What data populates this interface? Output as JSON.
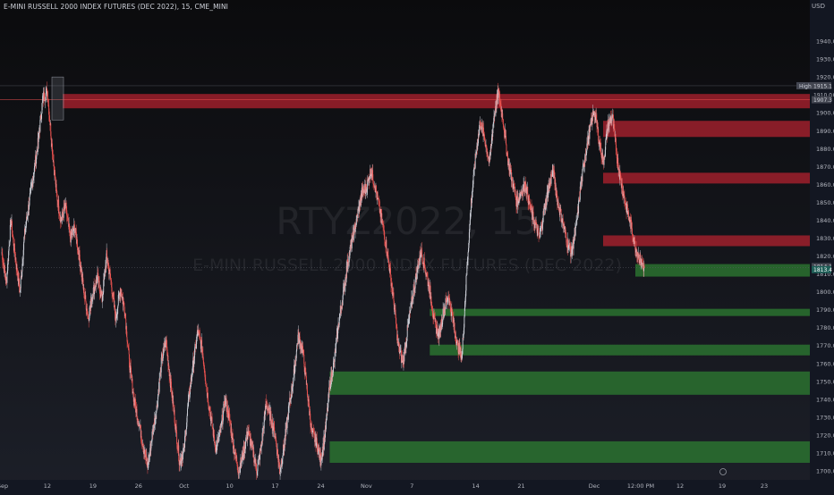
{
  "header": {
    "symbol_line": "E-MINI RUSSELL 2000 INDEX FUTURES (DEC 2022), 15, CME_MINI",
    "currency": "USD"
  },
  "watermark": {
    "symbol": "RTYZ2022, 15",
    "description": "E-MINI RUSSELL 2000 INDEX FUTURES (DEC 2022)"
  },
  "colors": {
    "background": "#131722",
    "supply_zone": "#b2222f",
    "demand_zone": "#2e7d32",
    "candle_up": "#d1d4dc",
    "candle_down": "#ef5350"
  },
  "chart_data": {
    "type": "candlestick",
    "ylim": [
      1696,
      1956
    ],
    "y_ticks": [
      1940,
      1930,
      1920,
      1910,
      1900,
      1890,
      1880,
      1870,
      1860,
      1850,
      1840,
      1830,
      1820,
      1810,
      1800,
      1790,
      1780,
      1770,
      1760,
      1750,
      1740,
      1730,
      1720,
      1710,
      1700
    ],
    "y_tick_labels": [
      "1940.0",
      "1930.0",
      "1920.0",
      "1910.0",
      "1900.0",
      "1890.0",
      "1880.0",
      "1870.0",
      "1860.0",
      "1850.0",
      "1840.0",
      "1830.0",
      "1820.0",
      "1810.0",
      "1800.0",
      "1790.0",
      "1780.0",
      "1770.0",
      "1760.0",
      "1750.0",
      "1740.0",
      "1730.0",
      "1720.0",
      "1710.0",
      "1700.0"
    ],
    "x_ticks": [
      "Sep",
      "12",
      "19",
      "26",
      "Oct",
      "10",
      "17",
      "24",
      "Nov",
      "7",
      "14",
      "21",
      "Dec",
      "12:00 PM",
      "12",
      "19",
      "23"
    ],
    "price_labels": [
      {
        "label": "High",
        "value": "1915.1"
      },
      {
        "label": "",
        "value": "1910.0"
      },
      {
        "label": "",
        "value": "1907.3"
      },
      {
        "label": "",
        "value": "1814.1"
      },
      {
        "label": "",
        "value": "1813.4"
      }
    ],
    "path": [
      [
        "Sep",
        1822
      ],
      [
        "",
        1805
      ],
      [
        "",
        1840
      ],
      [
        "",
        1818
      ],
      [
        "",
        1800
      ],
      [
        "",
        1832
      ],
      [
        "",
        1850
      ],
      [
        "",
        1866
      ],
      [
        "",
        1884
      ],
      [
        "",
        1908
      ],
      [
        "12",
        1912
      ],
      [
        "",
        1882
      ],
      [
        "",
        1855
      ],
      [
        "",
        1840
      ],
      [
        "",
        1848
      ],
      [
        "",
        1830
      ],
      [
        "",
        1836
      ],
      [
        "",
        1820
      ],
      [
        "",
        1800
      ],
      [
        "",
        1786
      ],
      [
        "19",
        1800
      ],
      [
        "",
        1808
      ],
      [
        "",
        1796
      ],
      [
        "",
        1820
      ],
      [
        "",
        1805
      ],
      [
        "",
        1785
      ],
      [
        "",
        1802
      ],
      [
        "",
        1790
      ],
      [
        "",
        1760
      ],
      [
        "",
        1740
      ],
      [
        "26",
        1728
      ],
      [
        "",
        1715
      ],
      [
        "",
        1702
      ],
      [
        "",
        1720
      ],
      [
        "",
        1735
      ],
      [
        "",
        1760
      ],
      [
        "",
        1773
      ],
      [
        "",
        1750
      ],
      [
        "",
        1728
      ],
      [
        "",
        1705
      ],
      [
        "Oct",
        1712
      ],
      [
        "",
        1740
      ],
      [
        "",
        1760
      ],
      [
        "",
        1778
      ],
      [
        "",
        1768
      ],
      [
        "",
        1745
      ],
      [
        "",
        1728
      ],
      [
        "",
        1712
      ],
      [
        "",
        1722
      ],
      [
        "",
        1740
      ],
      [
        "10",
        1728
      ],
      [
        "",
        1712
      ],
      [
        "",
        1700
      ],
      [
        "",
        1710
      ],
      [
        "",
        1722
      ],
      [
        "",
        1712
      ],
      [
        "",
        1700
      ],
      [
        "",
        1715
      ],
      [
        "",
        1738
      ],
      [
        "",
        1730
      ],
      [
        "17",
        1720
      ],
      [
        "",
        1700
      ],
      [
        "",
        1715
      ],
      [
        "",
        1735
      ],
      [
        "",
        1752
      ],
      [
        "",
        1775
      ],
      [
        "",
        1768
      ],
      [
        "",
        1745
      ],
      [
        "",
        1722
      ],
      [
        "",
        1716
      ],
      [
        "24",
        1706
      ],
      [
        "",
        1722
      ],
      [
        "",
        1748
      ],
      [
        "",
        1762
      ],
      [
        "",
        1784
      ],
      [
        "",
        1800
      ],
      [
        "",
        1818
      ],
      [
        "",
        1830
      ],
      [
        "",
        1842
      ],
      [
        "",
        1855
      ],
      [
        "Nov",
        1858
      ],
      [
        "",
        1868
      ],
      [
        "",
        1858
      ],
      [
        "",
        1845
      ],
      [
        "",
        1832
      ],
      [
        "",
        1815
      ],
      [
        "",
        1795
      ],
      [
        "",
        1770
      ],
      [
        "",
        1760
      ],
      [
        "",
        1778
      ],
      [
        "7",
        1795
      ],
      [
        "",
        1810
      ],
      [
        "",
        1823
      ],
      [
        "",
        1812
      ],
      [
        "",
        1800
      ],
      [
        "",
        1782
      ],
      [
        "",
        1776
      ],
      [
        "",
        1790
      ],
      [
        "",
        1798
      ],
      [
        "",
        1784
      ],
      [
        "",
        1770
      ],
      [
        "",
        1764
      ],
      [
        "",
        1810
      ],
      [
        "",
        1850
      ],
      [
        "14",
        1876
      ],
      [
        "",
        1895
      ],
      [
        "",
        1885
      ],
      [
        "",
        1872
      ],
      [
        "",
        1898
      ],
      [
        "",
        1912
      ],
      [
        "",
        1896
      ],
      [
        "",
        1875
      ],
      [
        "",
        1862
      ],
      [
        "",
        1850
      ],
      [
        "21",
        1856
      ],
      [
        "",
        1860
      ],
      [
        "",
        1846
      ],
      [
        "",
        1838
      ],
      [
        "",
        1830
      ],
      [
        "",
        1845
      ],
      [
        "",
        1858
      ],
      [
        "",
        1868
      ],
      [
        "",
        1850
      ],
      [
        "",
        1840
      ],
      [
        "",
        1828
      ],
      [
        "",
        1822
      ],
      [
        "",
        1835
      ],
      [
        "",
        1858
      ],
      [
        "",
        1876
      ],
      [
        "",
        1890
      ],
      [
        "Dec",
        1902
      ],
      [
        "",
        1886
      ],
      [
        "",
        1872
      ],
      [
        "",
        1893
      ],
      [
        "",
        1898
      ],
      [
        "",
        1875
      ],
      [
        "",
        1860
      ],
      [
        "",
        1848
      ],
      [
        "",
        1838
      ],
      [
        "",
        1826
      ],
      [
        "",
        1818
      ],
      [
        "12:00 PM",
        1813.4
      ]
    ],
    "supply_zones": [
      {
        "from": "12",
        "to": "end",
        "high": 1910.5,
        "low": 1902.5
      },
      {
        "from": "Dec",
        "to": "end",
        "high": 1895.5,
        "low": 1886.5
      },
      {
        "from": "Dec",
        "to": "end",
        "high": 1866.5,
        "low": 1860.5
      },
      {
        "from": "Dec",
        "to": "end",
        "high": 1831.5,
        "low": 1825.5
      }
    ],
    "demand_zones": [
      {
        "from": "12:00 PM",
        "to": "end",
        "high": 1815.5,
        "low": 1808.5
      },
      {
        "from": "7",
        "to": "end",
        "high": 1790.5,
        "low": 1786.5
      },
      {
        "from": "7",
        "to": "end",
        "high": 1770.5,
        "low": 1764.5
      },
      {
        "from": "24",
        "to": "end",
        "high": 1755.5,
        "low": 1742.5
      },
      {
        "from": "24",
        "to": "end",
        "high": 1716.5,
        "low": 1704.5
      }
    ]
  }
}
